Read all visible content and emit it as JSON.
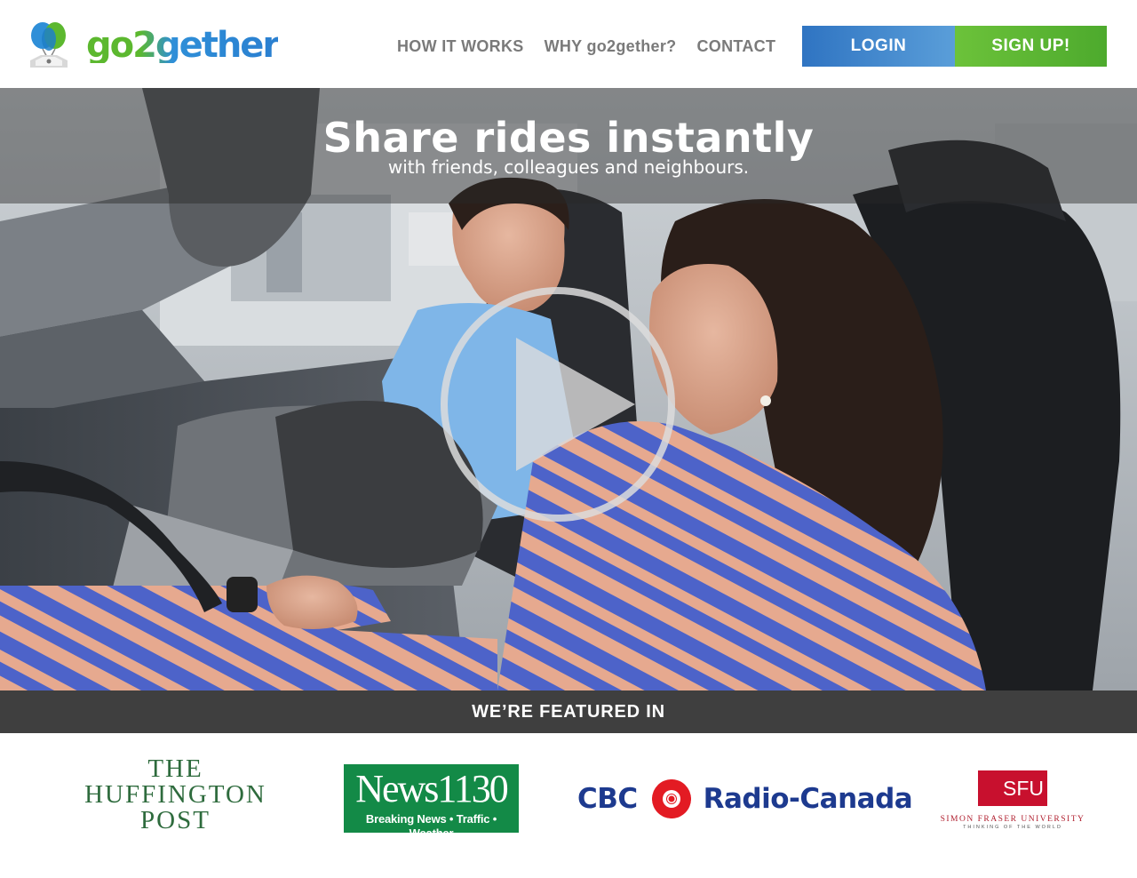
{
  "brand": {
    "name": "go2gether",
    "logo_icon": "balloon-pin-icon"
  },
  "nav": {
    "items": [
      {
        "label": "HOW IT WORKS"
      },
      {
        "label": "WHY go2gether?"
      },
      {
        "label": "CONTACT"
      }
    ],
    "login_label": "LOGIN",
    "signup_label": "SIGN UP!"
  },
  "hero": {
    "title": "Share rides instantly",
    "subtitle": "with friends, colleagues and neighbours.",
    "play_icon": "play-icon"
  },
  "featured": {
    "heading": "WE’RE FEATURED IN",
    "huffington": {
      "line1": "THE",
      "line2": "HUFFINGTON",
      "line3": "POST"
    },
    "news1130": {
      "title": "News1130",
      "tagline": "Breaking News • Traffic • Weather"
    },
    "cbc": {
      "left": "CBC",
      "right": "Radio-Canada"
    },
    "sfu": {
      "badge": "SFU",
      "name": "SIMON FRASER UNIVERSITY",
      "motto": "THINKING OF THE WORLD"
    }
  },
  "colors": {
    "login": "#2f74c2",
    "signup": "#5cb82f",
    "featured_bar": "#3f3f3f",
    "nav_text": "#7a7a7a"
  }
}
